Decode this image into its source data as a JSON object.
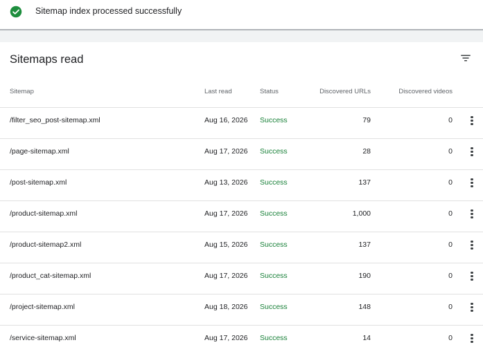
{
  "banner": {
    "message": "Sitemap index processed successfully",
    "icon": "check-circle-icon",
    "icon_color": "#1e8e3e"
  },
  "card": {
    "title": "Sitemaps read",
    "filter_icon": "filter-icon"
  },
  "table": {
    "headers": {
      "sitemap": "Sitemap",
      "last_read": "Last read",
      "status": "Status",
      "discovered_urls": "Discovered URLs",
      "discovered_videos": "Discovered videos"
    },
    "status_color": "#188038",
    "rows": [
      {
        "sitemap": "/filter_seo_post-sitemap.xml",
        "last_read": "Aug 16, 2026",
        "status": "Success",
        "urls": "79",
        "videos": "0"
      },
      {
        "sitemap": "/page-sitemap.xml",
        "last_read": "Aug 17, 2026",
        "status": "Success",
        "urls": "28",
        "videos": "0"
      },
      {
        "sitemap": "/post-sitemap.xml",
        "last_read": "Aug 13, 2026",
        "status": "Success",
        "urls": "137",
        "videos": "0"
      },
      {
        "sitemap": "/product-sitemap.xml",
        "last_read": "Aug 17, 2026",
        "status": "Success",
        "urls": "1,000",
        "videos": "0"
      },
      {
        "sitemap": "/product-sitemap2.xml",
        "last_read": "Aug 15, 2026",
        "status": "Success",
        "urls": "137",
        "videos": "0"
      },
      {
        "sitemap": "/product_cat-sitemap.xml",
        "last_read": "Aug 17, 2026",
        "status": "Success",
        "urls": "190",
        "videos": "0"
      },
      {
        "sitemap": "/project-sitemap.xml",
        "last_read": "Aug 18, 2026",
        "status": "Success",
        "urls": "148",
        "videos": "0"
      },
      {
        "sitemap": "/service-sitemap.xml",
        "last_read": "Aug 17, 2026",
        "status": "Success",
        "urls": "14",
        "videos": "0"
      }
    ]
  }
}
